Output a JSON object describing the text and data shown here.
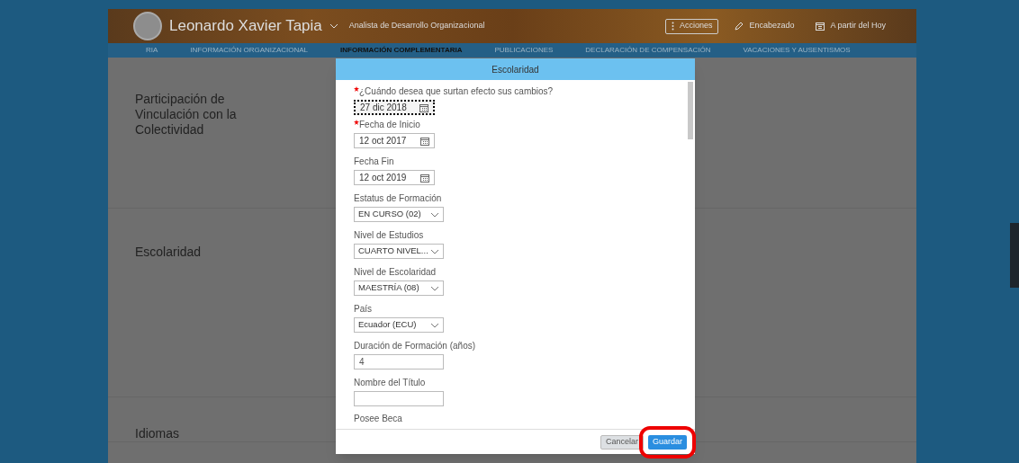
{
  "header": {
    "name": "Leonardo Xavier Tapia",
    "subtitle": "Analista de Desarrollo Organizacional",
    "actions": [
      {
        "kind": "menu",
        "label": "Acciones"
      },
      {
        "kind": "edit",
        "label": "Encabezado"
      },
      {
        "kind": "date",
        "label": "A partir del Hoy"
      }
    ]
  },
  "tabs": [
    {
      "label": "RIA",
      "selected": false
    },
    {
      "label": "INFORMACIÓN ORGANIZACIONAL",
      "selected": false
    },
    {
      "label": "INFORMACIÓN COMPLEMENTARIA",
      "selected": true
    },
    {
      "label": "PUBLICACIONES",
      "selected": false
    },
    {
      "label": "DECLARACIÓN DE COMPENSACIÓN",
      "selected": false
    },
    {
      "label": "VACACIONES Y AUSENTISMOS",
      "selected": false
    }
  ],
  "sections": [
    "Participación de Vinculación con la Colectividad",
    "Escolaridad",
    "Idiomas"
  ],
  "dialog": {
    "title": "Escolaridad",
    "fields": [
      {
        "kind": "date",
        "label": "¿Cuándo desea que surtan efecto sus cambios?",
        "value": "27 dic 2018",
        "required": true,
        "focused": true
      },
      {
        "kind": "date",
        "label": "Fecha de Inicio",
        "value": "12 oct 2017",
        "required": true,
        "focused": false
      },
      {
        "kind": "date",
        "label": "Fecha Fin",
        "value": "12 oct 2019",
        "required": false,
        "focused": false
      },
      {
        "kind": "select",
        "label": "Estatus de Formación",
        "value": "EN CURSO (02)",
        "required": false,
        "focused": false
      },
      {
        "kind": "select",
        "label": "Nivel de Estudios",
        "value": "CUARTO NIVEL...",
        "required": false,
        "focused": false
      },
      {
        "kind": "select",
        "label": "Nivel de Escolaridad",
        "value": "MAESTRÍA (08)",
        "required": false,
        "focused": false
      },
      {
        "kind": "select",
        "label": "País",
        "value": "Ecuador (ECU)",
        "required": false,
        "focused": false
      },
      {
        "kind": "readonly",
        "label": "Duración de Formación (años)",
        "value": "4",
        "required": false,
        "focused": false
      },
      {
        "kind": "text",
        "label": "Nombre del Título",
        "required": false,
        "focused": false
      },
      {
        "kind": "label",
        "label": "Posee Beca",
        "required": false
      }
    ],
    "buttons": [
      {
        "kind": "secondary",
        "label": "Cancelar",
        "highlighted": false
      },
      {
        "kind": "primary",
        "label": "Guardar",
        "highlighted": true
      }
    ]
  }
}
